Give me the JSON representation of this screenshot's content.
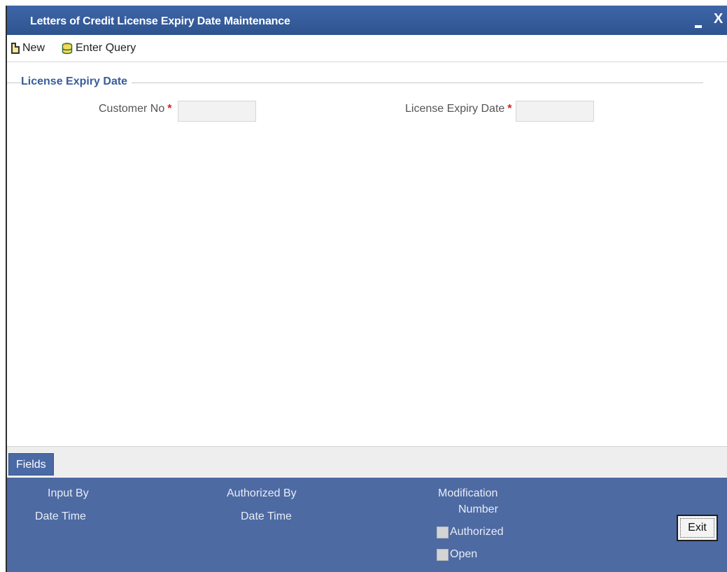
{
  "window": {
    "title": "Letters of Credit License Expiry Date Maintenance",
    "close_symbol": "X",
    "accent_color": "#2e548f"
  },
  "toolbar": {
    "new_label": "New",
    "enter_query_label": "Enter Query",
    "new_icon": "document-icon",
    "query_icon": "database-icon"
  },
  "section": {
    "title": "License Expiry Date",
    "fields": {
      "customer_no": {
        "label": "Customer No",
        "required_mark": "*",
        "value": ""
      },
      "license_expiry_date": {
        "label": "License Expiry Date",
        "required_mark": "*",
        "value": ""
      }
    }
  },
  "fields_tab": {
    "label": "Fields"
  },
  "footer": {
    "input_by": "Input By",
    "date_time_1": "Date Time",
    "authorized_by": "Authorized By",
    "date_time_2": "Date Time",
    "modification": "Modification",
    "number": "Number",
    "authorized": "Authorized",
    "open": "Open",
    "exit_label": "Exit",
    "background_color": "#4d6aa3"
  }
}
